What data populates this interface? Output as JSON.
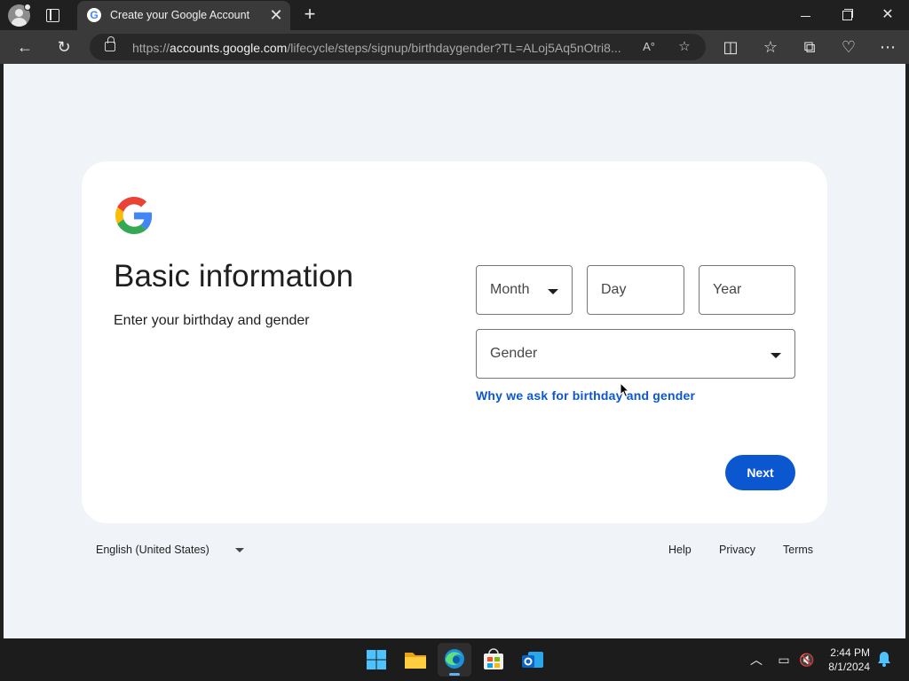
{
  "browser": {
    "tab_title": "Create your Google Account",
    "url_prefix": "https://",
    "url_host": "accounts.google.com",
    "url_path": "/lifecycle/steps/signup/birthdaygender?TL=ALoj5Aq5nOtri8..."
  },
  "page": {
    "title": "Basic information",
    "subtitle": "Enter your birthday and gender",
    "month_placeholder": "Month",
    "day_placeholder": "Day",
    "year_placeholder": "Year",
    "gender_placeholder": "Gender",
    "why_link": "Why we ask for birthday and gender",
    "next_label": "Next"
  },
  "footer": {
    "language": "English (United States)",
    "help": "Help",
    "privacy": "Privacy",
    "terms": "Terms"
  },
  "taskbar": {
    "time": "2:44 PM",
    "date": "8/1/2024"
  },
  "icons": {
    "google_colors": [
      "#4285F4",
      "#EA4335",
      "#FBBC05",
      "#34A853"
    ]
  },
  "colors": {
    "accent": "#0b57d0",
    "page_background": "#f0f4f9"
  }
}
